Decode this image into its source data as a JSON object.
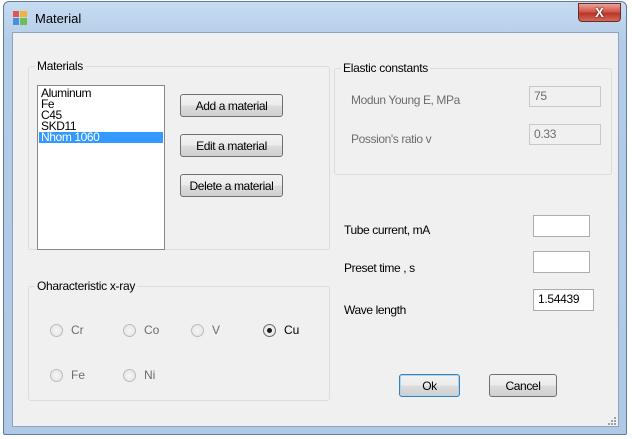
{
  "window": {
    "title": "Material",
    "close_label": "X"
  },
  "materials_group": {
    "title": "Materials",
    "items": [
      "Aluminum",
      "Fe",
      "C45",
      "SKD11",
      "Nhom 1060"
    ],
    "selected_index": 4,
    "buttons": {
      "add": "Add a material",
      "edit": "Edit a material",
      "delete": "Delete a material"
    }
  },
  "elastic_group": {
    "title": "Elastic constants",
    "young_label": "Modun Young E, MPa",
    "young_value": "75",
    "poisson_label": "Possion's ratio v",
    "poisson_value": "0.33"
  },
  "xray_group": {
    "title": "Oharacteristic x-ray",
    "options": [
      "Cr",
      "Co",
      "V",
      "Cu",
      "Fe",
      "Ni"
    ],
    "selected": "Cu"
  },
  "parameters": {
    "tube_current_label": "Tube current, mA",
    "tube_current_value": "",
    "preset_time_label": "Preset time , s",
    "preset_time_value": "",
    "wave_length_label": "Wave length",
    "wave_length_value": "1.54439"
  },
  "footer": {
    "ok": "Ok",
    "cancel": "Cancel"
  }
}
